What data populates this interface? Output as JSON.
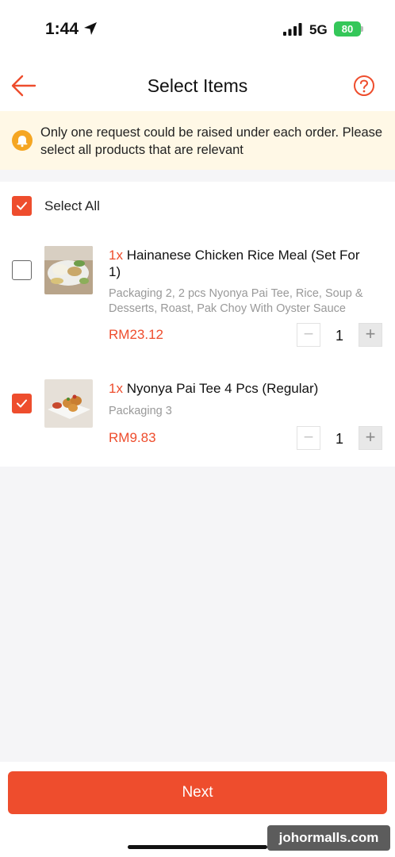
{
  "status_bar": {
    "time": "1:44",
    "network": "5G",
    "battery": "80"
  },
  "header": {
    "title": "Select Items",
    "back_icon": "arrow-left-icon",
    "help_icon": "question-circle-icon"
  },
  "notice": {
    "icon": "bell-icon",
    "text": "Only one request could be raised under each order. Please select all products that are relevant"
  },
  "select_all": {
    "label": "Select All",
    "checked": true
  },
  "items": [
    {
      "checked": false,
      "qty": "1x",
      "name": "Hainanese Chicken Rice Meal (Set For 1)",
      "description": "Packaging 2, 2 pcs Nyonya Pai Tee, Rice, Soup & Desserts, Roast, Pak Choy With Oyster Sauce",
      "price": "RM23.12",
      "stepper_value": "1"
    },
    {
      "checked": true,
      "qty": "1x",
      "name": "Nyonya Pai Tee 4 Pcs (Regular)",
      "description": "Packaging 3",
      "price": "RM9.83",
      "stepper_value": "1"
    }
  ],
  "footer": {
    "next_label": "Next"
  },
  "watermark": "johormalls.com",
  "colors": {
    "accent": "#ee4d2d",
    "notice_bg": "#fff8e6",
    "notice_icon": "#f5a623"
  }
}
